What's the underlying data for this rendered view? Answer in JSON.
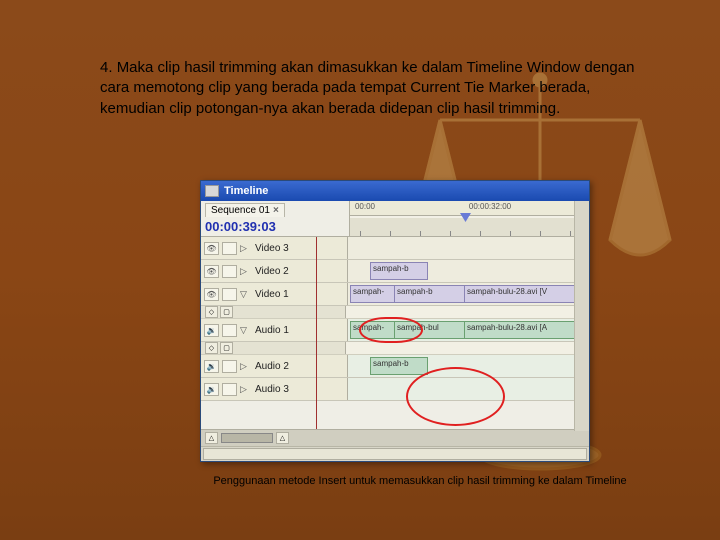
{
  "instruction": {
    "number": "4.",
    "text": "Maka clip hasil trimming akan dimasukkan ke dalam Timeline Window dengan cara memotong clip yang berada pada tempat Current Tie Marker berada, kemudian clip potongan-nya akan berada didepan clip hasil trimming."
  },
  "timeline": {
    "title": "Timeline",
    "sequence_tab": "Sequence 01",
    "close_x": "×",
    "timecode": "00:00:39:03",
    "ruler": {
      "marks": [
        "00:00",
        "00:00:32:00"
      ]
    },
    "tracks": {
      "video3": {
        "name": "Video 3"
      },
      "video2": {
        "name": "Video 2",
        "clips": [
          {
            "label": "sampah-b"
          }
        ]
      },
      "video1": {
        "name": "Video 1",
        "clips": [
          {
            "label": "sampah-"
          },
          {
            "label": "sampah-b"
          },
          {
            "label": "sampah-bulu-28.avi [V"
          }
        ]
      },
      "audio1": {
        "name": "Audio 1",
        "clips": [
          {
            "label": "sampah-"
          },
          {
            "label": "sampah-bul"
          },
          {
            "label": "sampah-bulu-28.avi [A"
          }
        ]
      },
      "audio2": {
        "name": "Audio 2",
        "clips": [
          {
            "label": "sampah-b"
          }
        ]
      },
      "audio3": {
        "name": "Audio 3"
      }
    }
  },
  "caption": "Penggunaan metode Insert untuk memasukkan clip hasil trimming ke dalam Timeline"
}
